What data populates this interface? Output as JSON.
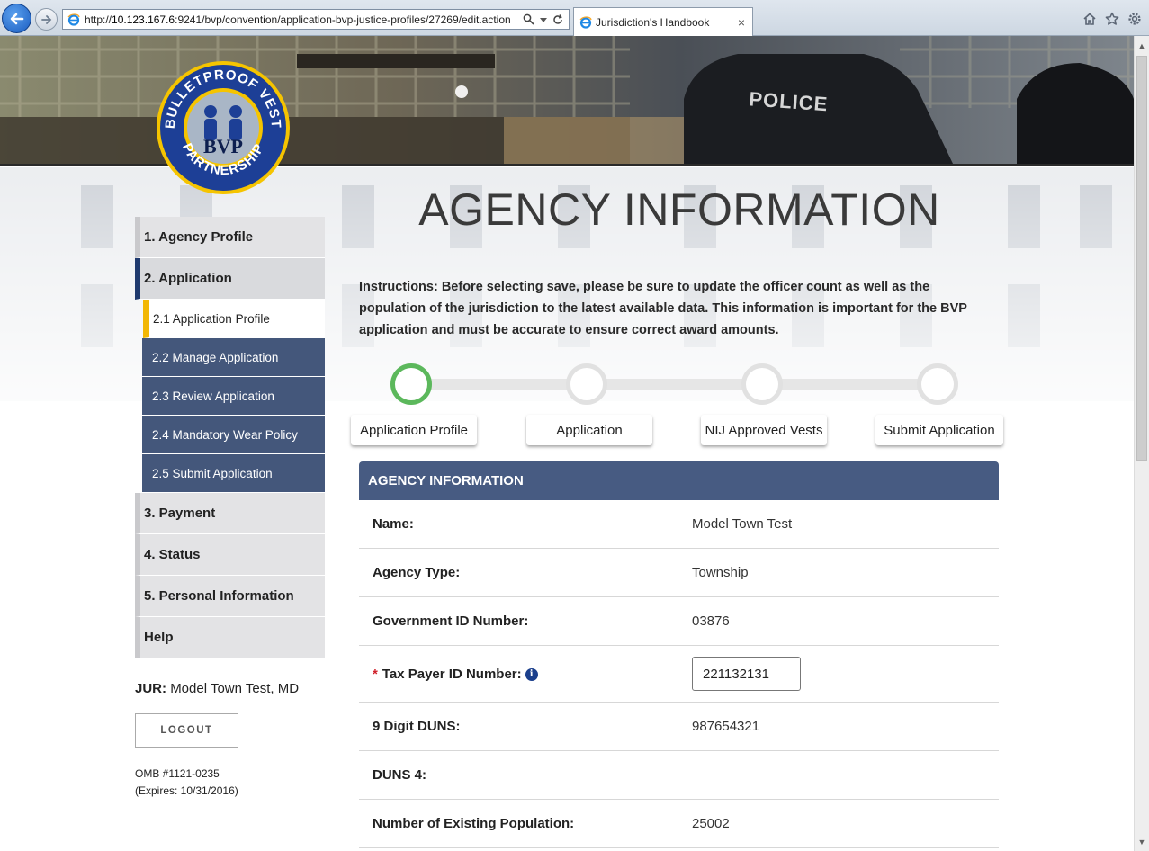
{
  "browser": {
    "url_prefix": "http://",
    "url_host": "10.123.167.6",
    "url_rest": ":9241/bvp/convention/application-bvp-justice-profiles/27269/edit.action",
    "tab_title": "Jurisdiction's Handbook",
    "tab_close": "×"
  },
  "banner": {
    "police_text": "POLICE",
    "logo_top_text": "BULLETPROOF VEST",
    "logo_bottom_text": "PARTNERSHIP",
    "logo_mark": "BVP"
  },
  "page": {
    "title": "AGENCY INFORMATION",
    "instructions": "Instructions: Before selecting save, please be sure to update the officer count as well as the population of the jurisdiction to the latest available data. This information is important for the BVP application and must be accurate to ensure correct award amounts."
  },
  "sidebar": {
    "items": [
      {
        "label": "1. Agency Profile"
      },
      {
        "label": "2. Application"
      },
      {
        "label": "3. Payment"
      },
      {
        "label": "4. Status"
      },
      {
        "label": "5. Personal Information"
      },
      {
        "label": "Help"
      }
    ],
    "subitems": [
      {
        "label": "2.1 Application Profile"
      },
      {
        "label": "2.2 Manage Application"
      },
      {
        "label": "2.3 Review Application"
      },
      {
        "label": "2.4 Mandatory Wear Policy"
      },
      {
        "label": "2.5 Submit Application"
      }
    ],
    "jur_label": "JUR:",
    "jur_value": "Model Town Test, MD",
    "logout_label": "LOGOUT",
    "omb_number": "OMB #1121-0235",
    "omb_expires": "(Expires: 10/31/2016)"
  },
  "steps": [
    {
      "label": "Application Profile",
      "status": "current"
    },
    {
      "label": "Application",
      "status": "pending"
    },
    {
      "label": "NIJ Approved Vests",
      "status": "pending"
    },
    {
      "label": "Submit Application",
      "status": "pending"
    }
  ],
  "agency": {
    "header": "AGENCY INFORMATION",
    "name_label": "Name:",
    "name_value": "Model Town Test",
    "type_label": "Agency Type:",
    "type_value": "Township",
    "gov_label": "Government ID Number:",
    "gov_value": "03876",
    "tax_required": "*",
    "tax_label": "Tax Payer ID Number:",
    "tax_info_glyph": "i",
    "tax_value": "221132131",
    "duns9_label": "9 Digit DUNS:",
    "duns9_value": "987654321",
    "duns4_label": "DUNS 4:",
    "duns4_value": "",
    "pop_label": "Number of Existing Population:",
    "pop_value": "25002"
  },
  "colors": {
    "nav_dark": "#44577b",
    "panel_header": "#475b82",
    "active_marker": "#f2b705",
    "step_done": "#5cb85c",
    "required": "#d0202a"
  }
}
